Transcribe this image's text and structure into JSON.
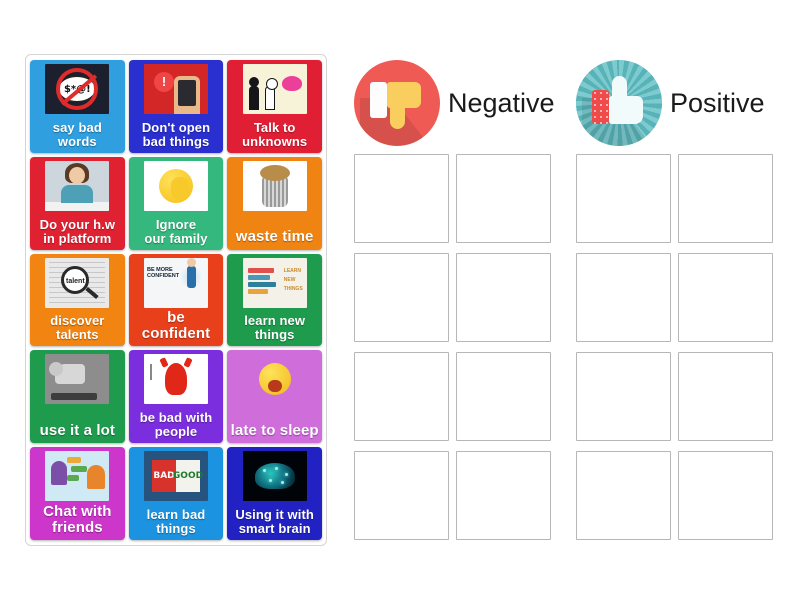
{
  "activity": {
    "type": "sorting-game",
    "panel_tiles": [
      {
        "label": "say bad words",
        "color": "#2f9fe0",
        "art": "art-noswear",
        "size": "med"
      },
      {
        "label": "Don't open\nbad things",
        "color": "#2a2fd0",
        "art": "art-phone",
        "size": "med"
      },
      {
        "label": "Talk to\nunknowns",
        "color": "#e01f35",
        "art": "art-stranger",
        "size": "med"
      },
      {
        "label": "Do your h.w\nin platform",
        "color": "#e02132",
        "art": "art-girl",
        "size": "med"
      },
      {
        "label": "Ignore\nour family",
        "color": "#35b87e",
        "art": "art-facepalm",
        "size": "med"
      },
      {
        "label": "waste time",
        "color": "#f08413",
        "art": "art-trash",
        "size": "big"
      },
      {
        "label": "discover\ntalents",
        "color": "#f28411",
        "art": "art-talent",
        "size": "med"
      },
      {
        "label": "be\nconfident",
        "color": "#e8401b",
        "art": "art-conf",
        "size": "big"
      },
      {
        "label": "learn new\nthings",
        "color": "#1f9b4e",
        "art": "art-learn",
        "size": "med"
      },
      {
        "label": "use it a lot",
        "color": "#1f9b4e",
        "art": "art-use",
        "size": "big"
      },
      {
        "label": "be bad with\npeople",
        "color": "#7b2ede",
        "art": "art-devil",
        "size": "med"
      },
      {
        "label": "late to sleep",
        "color": "#cf6ddb",
        "art": "art-yawn",
        "size": "big"
      },
      {
        "label": "Chat with\nfriends",
        "color": "#cd36ca",
        "art": "art-chat",
        "size": "big"
      },
      {
        "label": "learn bad\nthings",
        "color": "#1b93e0",
        "art": "art-badgood",
        "size": "med"
      },
      {
        "label": "Using it with\nsmart brain",
        "color": "#2222c4",
        "art": "art-brain",
        "size": "med"
      }
    ],
    "categories": [
      {
        "title": "Negative",
        "icon": "thumbs-down-icon",
        "icon_circle_color": "#ef5a55",
        "slot_count": 8,
        "dropped_items": []
      },
      {
        "title": "Positive",
        "icon": "thumbs-up-icon",
        "icon_circle_color": "#58b3b8",
        "slot_count": 8,
        "dropped_items": []
      }
    ]
  }
}
